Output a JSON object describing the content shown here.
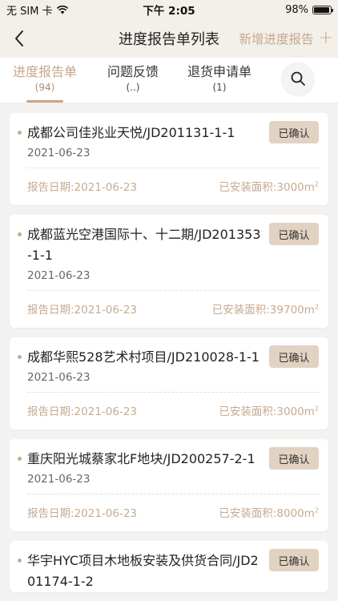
{
  "status_bar": {
    "carrier": "无 SIM 卡",
    "time": "下午 2:05",
    "battery": "98%"
  },
  "nav": {
    "title": "进度报告单列表",
    "right_action": "新增进度报告"
  },
  "tabs": [
    {
      "label": "进度报告单",
      "count": "(94)"
    },
    {
      "label": "问题反馈",
      "count": "(..)"
    },
    {
      "label": "退货申请单",
      "count": "(1)"
    }
  ],
  "cards": [
    {
      "title": "成都公司佳兆业天悦/JD201131-1-1",
      "date": "2021-06-23",
      "status": "已确认",
      "report_date": "报告日期:2021-06-23",
      "area": "已安装面积:3000m"
    },
    {
      "title": "成都蓝光空港国际十、十二期/JD201353-1-1",
      "date": "2021-06-23",
      "status": "已确认",
      "report_date": "报告日期:2021-06-23",
      "area": "已安装面积:39700m"
    },
    {
      "title": "成都华熙528艺术村项目/JD210028-1-1",
      "date": "2021-06-23",
      "status": "已确认",
      "report_date": "报告日期:2021-06-23",
      "area": "已安装面积:3000m"
    },
    {
      "title": "重庆阳光城蔡家北F地块/JD200257-2-1",
      "date": "2021-06-23",
      "status": "已确认",
      "report_date": "报告日期:2021-06-23",
      "area": "已安装面积:8000m"
    },
    {
      "title": "华宇HYC项目木地板安装及供货合同/JD201174-1-2",
      "date": "",
      "status": "已确认",
      "report_date": "",
      "area": ""
    }
  ],
  "area_unit_sup": "2"
}
